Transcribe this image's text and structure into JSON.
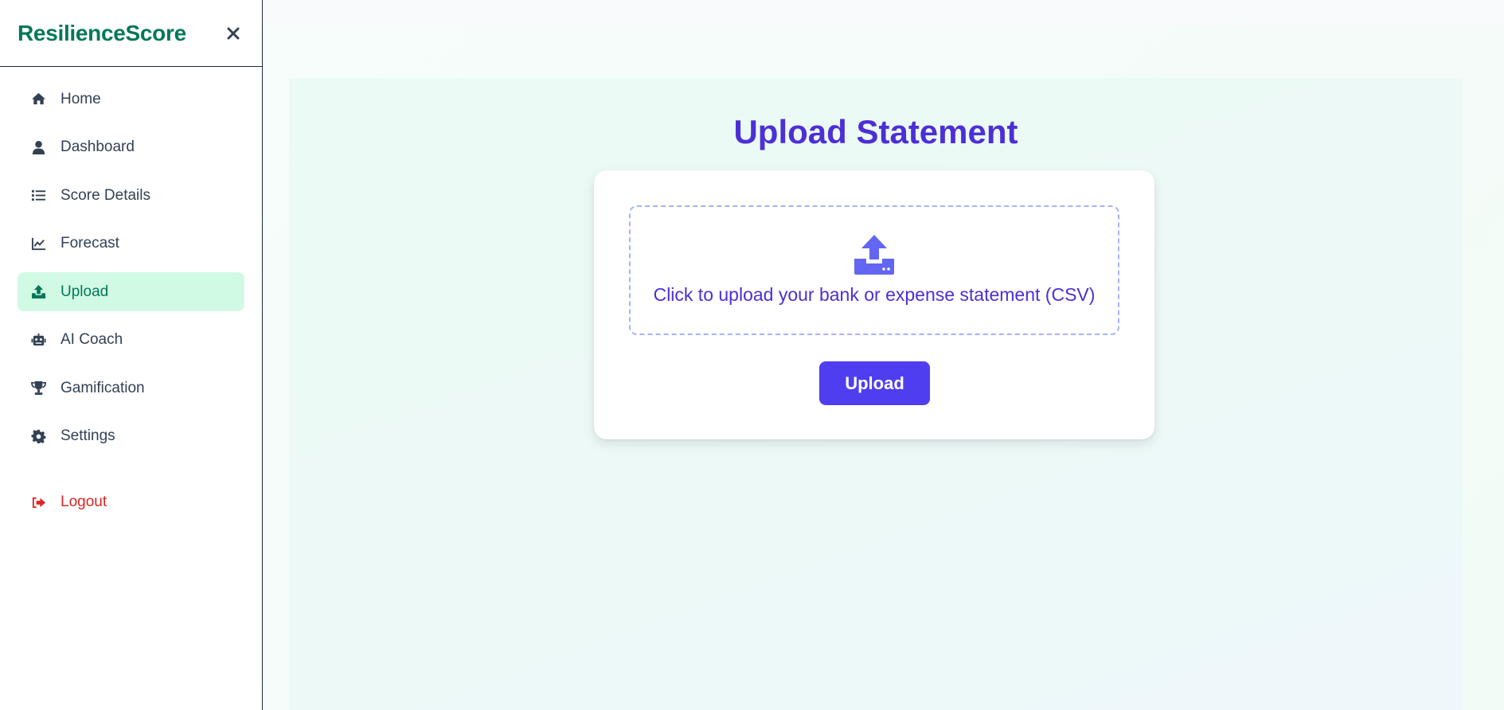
{
  "brand": "ResilienceScore",
  "sidebar": {
    "close_icon": "close-icon",
    "items": [
      {
        "label": "Home",
        "icon": "home-icon"
      },
      {
        "label": "Dashboard",
        "icon": "user-icon"
      },
      {
        "label": "Score Details",
        "icon": "list-icon"
      },
      {
        "label": "Forecast",
        "icon": "line-chart-icon"
      },
      {
        "label": "Upload",
        "icon": "upload-icon",
        "active": true
      },
      {
        "label": "AI Coach",
        "icon": "robot-icon"
      },
      {
        "label": "Gamification",
        "icon": "trophy-icon"
      },
      {
        "label": "Settings",
        "icon": "gear-icon"
      }
    ],
    "logout": {
      "label": "Logout",
      "icon": "sign-out-icon"
    }
  },
  "main": {
    "title": "Upload Statement",
    "dropzone_text": "Click to upload your bank or expense statement (CSV)",
    "upload_button": "Upload"
  },
  "colors": {
    "brand": "#047857",
    "accent": "#4f3ef0",
    "title": "#4c2fd6",
    "active_bg": "#d1fae5",
    "logout": "#dc2626"
  }
}
